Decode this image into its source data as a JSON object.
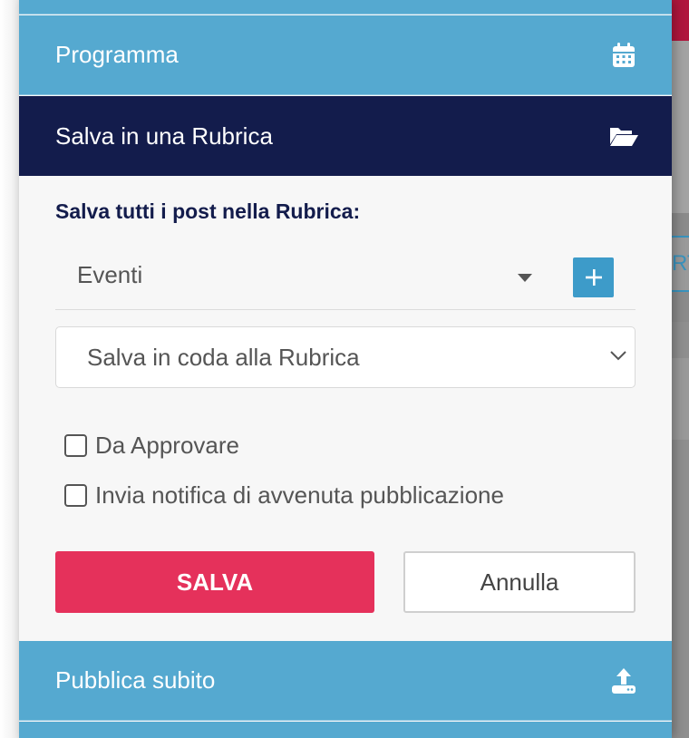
{
  "panel": {
    "programma_label": "Programma",
    "programma_icon": "calendar-icon",
    "rubrica_header_label": "Salva in una Rubrica",
    "rubrica_header_icon": "folder-open-icon",
    "pubblica_label": "Pubblica subito",
    "pubblica_icon": "upload-icon"
  },
  "form": {
    "section_title": "Salva tutti i post nella Rubrica:",
    "rubrica_value": "Eventi",
    "add_rubrica_icon": "plus-icon",
    "mode_value": "Salva in coda alla Rubrica",
    "checkbox_approvare": "Da Approvare",
    "checkbox_notifica": "Invia notifica di avvenuta pubblicazione",
    "save_label": "SALVA",
    "cancel_label": "Annulla"
  },
  "background": {
    "fragment_text": "RT"
  },
  "colors": {
    "accent_blue": "#55a9d0",
    "header_navy": "#131c4c",
    "save_red": "#e5315b",
    "add_button_blue": "#3d9bc9"
  }
}
